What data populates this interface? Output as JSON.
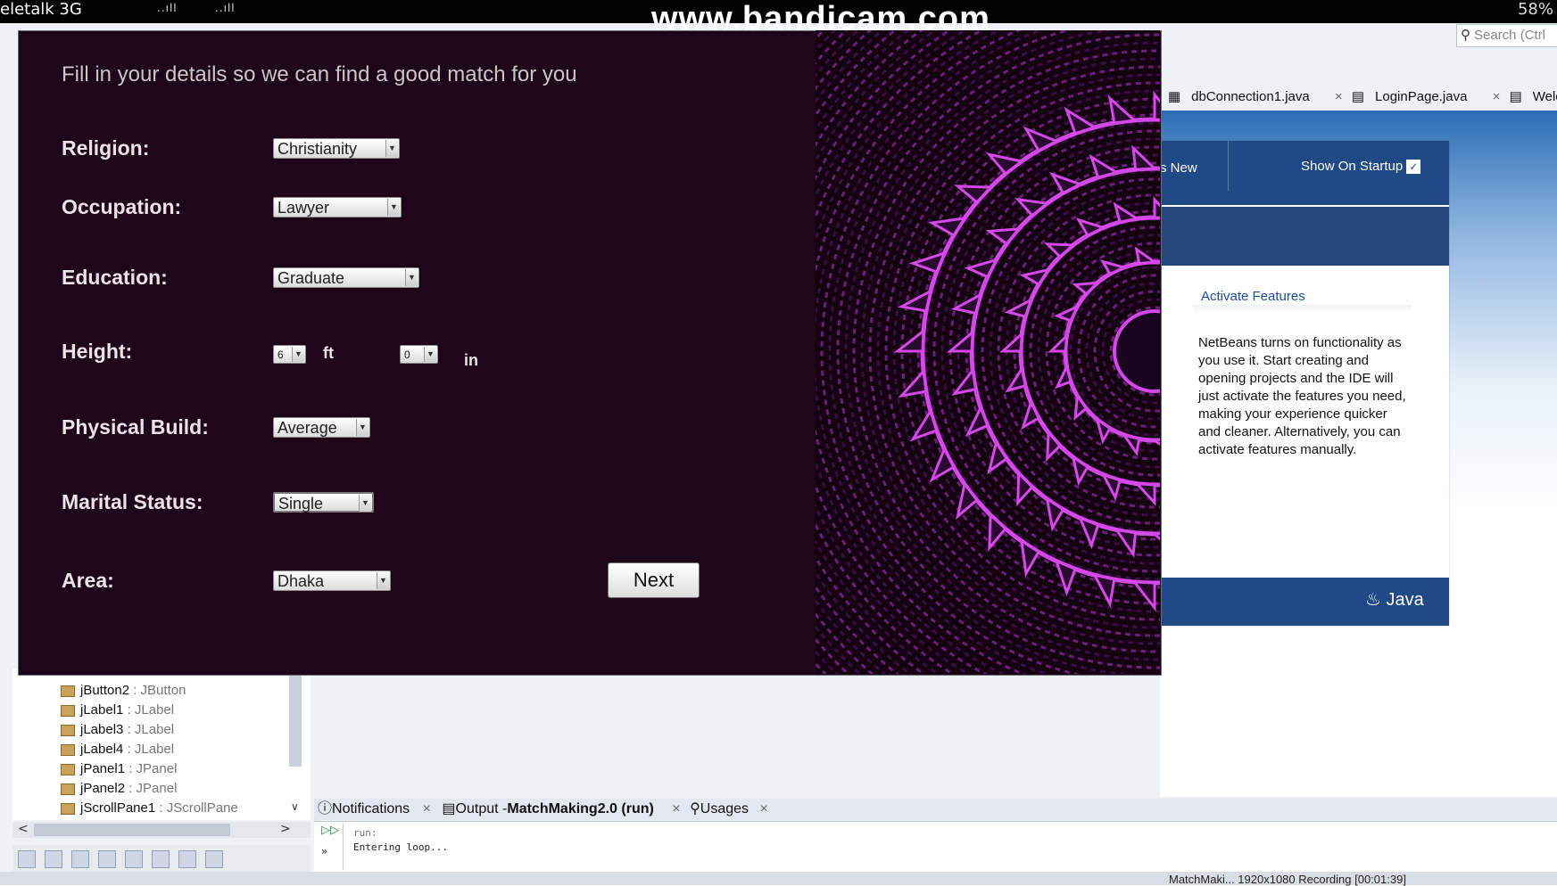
{
  "phone_status": {
    "carrier": "eletalk 3G",
    "signal_1": "..ıll",
    "signal_2": "..ıll",
    "battery": "58%"
  },
  "watermark": "www.bandicam.com",
  "ide": {
    "search_placeholder": "Search (Ctrl",
    "editor_tabs": [
      {
        "label": "dbConnection1.java"
      },
      {
        "label": "LoginPage.java"
      },
      {
        "label": "Welcom"
      }
    ],
    "welcome": {
      "whats_new": "s New",
      "show_on_startup": "Show On Startup",
      "activate_title": "Activate Features",
      "activate_text": "NetBeans turns on functionality as you use it. Start creating and opening projects and the IDE will just activate the features you need, making your experience quicker and cleaner. Alternatively, you can activate features manually.",
      "java_logo": "Java"
    },
    "navigator": {
      "items": [
        {
          "name": "jButton2",
          "type": ": JButton"
        },
        {
          "name": "jLabel1",
          "type": ": JLabel"
        },
        {
          "name": "jLabel3",
          "type": ": JLabel"
        },
        {
          "name": "jLabel4",
          "type": ": JLabel"
        },
        {
          "name": "jPanel1",
          "type": ": JPanel"
        },
        {
          "name": "jPanel2",
          "type": ": JPanel"
        },
        {
          "name": "jScrollPane1",
          "type": ": JScrollPane"
        }
      ]
    },
    "output": {
      "tabs": {
        "notifications": "Notifications",
        "output_prefix": "Output - ",
        "output_project": "MatchMaking2.0 (run)",
        "usages": "Usages"
      },
      "lines": [
        "run:",
        "Entering loop..."
      ]
    },
    "status_bar": "MatchMaki...  1920x1080  Recording [00:01:39]"
  },
  "form": {
    "headline": "Fill in your details so we can find a good match for you",
    "fields": {
      "religion": {
        "label": "Religion:",
        "value": "Christianity"
      },
      "occupation": {
        "label": "Occupation:",
        "value": "Lawyer"
      },
      "education": {
        "label": "Education:",
        "value": "Graduate"
      },
      "height": {
        "label": "Height:",
        "feet": "6",
        "feet_unit": "ft",
        "inches": "0",
        "inches_unit": "in"
      },
      "physical_build": {
        "label": "Physical Build:",
        "value": "Average"
      },
      "marital_status": {
        "label": "Marital Status:",
        "value": "Single"
      },
      "area": {
        "label": "Area:",
        "value": "Dhaka"
      }
    },
    "next_label": "Next"
  },
  "colors": {
    "dialog_bg": "#1e0517",
    "label_text": "#ece3e8",
    "mandala_accent": "#d448e8",
    "welcome_header": "#1f4a86"
  }
}
